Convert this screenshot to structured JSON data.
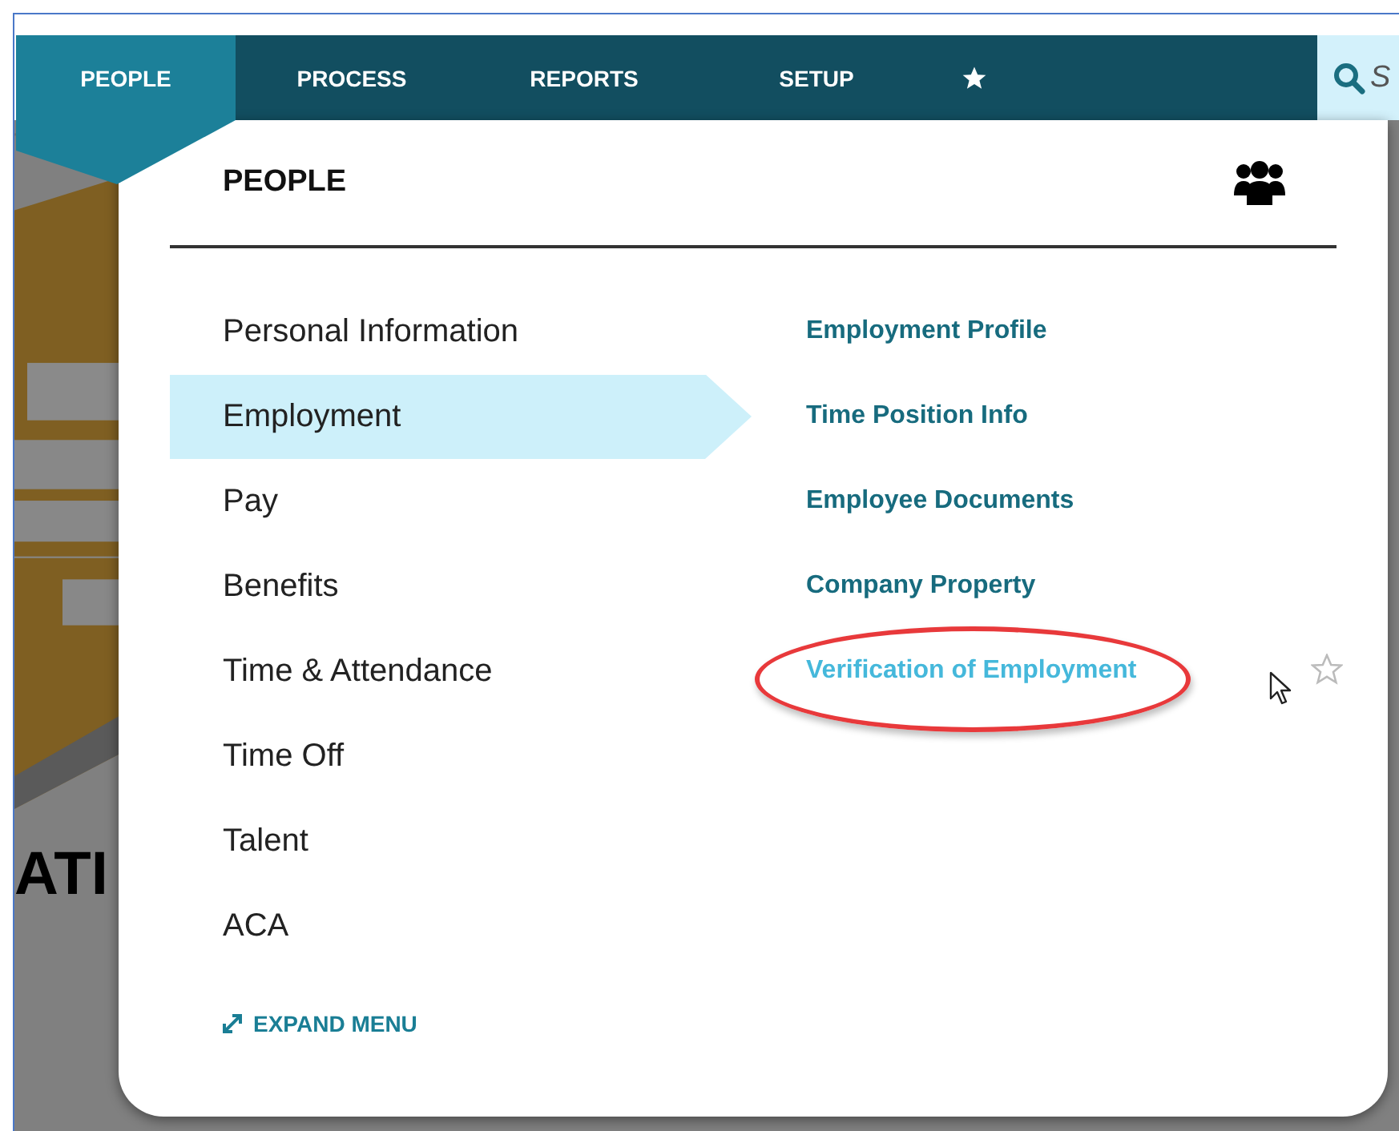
{
  "nav": {
    "tabs": [
      {
        "kind": "text",
        "label": "PEOPLE",
        "selected": true
      },
      {
        "kind": "text",
        "label": "PROCESS",
        "selected": false
      },
      {
        "kind": "text",
        "label": "REPORTS",
        "selected": false
      },
      {
        "kind": "text",
        "label": "SETUP",
        "selected": false
      },
      {
        "kind": "star",
        "selected": false
      }
    ],
    "search": {
      "placeholder": "S"
    }
  },
  "background": {
    "heading": "ATI"
  },
  "menu": {
    "title": "PEOPLE",
    "categories": [
      {
        "label": "Personal Information",
        "selected": false
      },
      {
        "label": "Employment",
        "selected": true
      },
      {
        "label": "Pay",
        "selected": false
      },
      {
        "label": "Benefits",
        "selected": false
      },
      {
        "label": "Time & Attendance",
        "selected": false
      },
      {
        "label": "Time Off",
        "selected": false
      },
      {
        "label": "Talent",
        "selected": false
      },
      {
        "label": "ACA",
        "selected": false
      }
    ],
    "links": [
      {
        "label": "Employment Profile",
        "hovered": false,
        "circled": false
      },
      {
        "label": "Time Position Info",
        "hovered": false,
        "circled": false
      },
      {
        "label": "Employee Documents",
        "hovered": false,
        "circled": false
      },
      {
        "label": "Company Property",
        "hovered": false,
        "circled": false
      },
      {
        "label": "Verification of Employment",
        "hovered": true,
        "circled": true
      }
    ],
    "expand": "EXPAND MENU"
  }
}
